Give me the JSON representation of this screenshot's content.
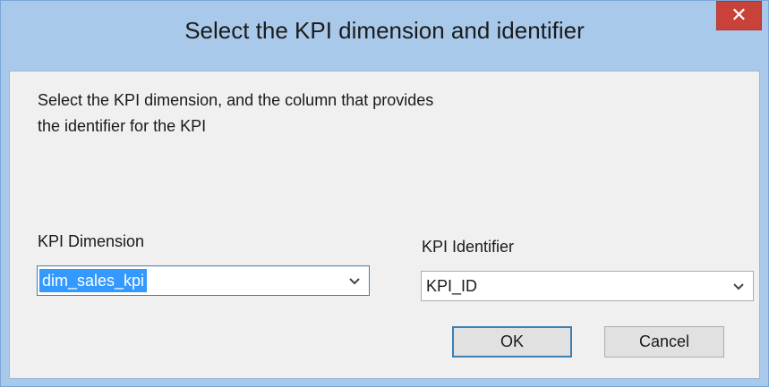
{
  "dialog": {
    "title": "Select the KPI dimension and identifier",
    "close_label": "✕",
    "description_line1": "Select the KPI dimension, and the column that provides",
    "description_line2": "the identifier for the KPI"
  },
  "fields": {
    "dimension": {
      "label": "KPI Dimension",
      "value": "dim_sales_kpi"
    },
    "identifier": {
      "label": "KPI Identifier",
      "value": "KPI_ID"
    }
  },
  "buttons": {
    "ok": "OK",
    "cancel": "Cancel"
  },
  "icons": {
    "dropdown": "chevron-down-icon",
    "close": "close-icon"
  },
  "colors": {
    "titlebar": "#a9c9ea",
    "close": "#c9423a",
    "selection": "#3399ff",
    "focus_border": "#3c7fb1"
  }
}
